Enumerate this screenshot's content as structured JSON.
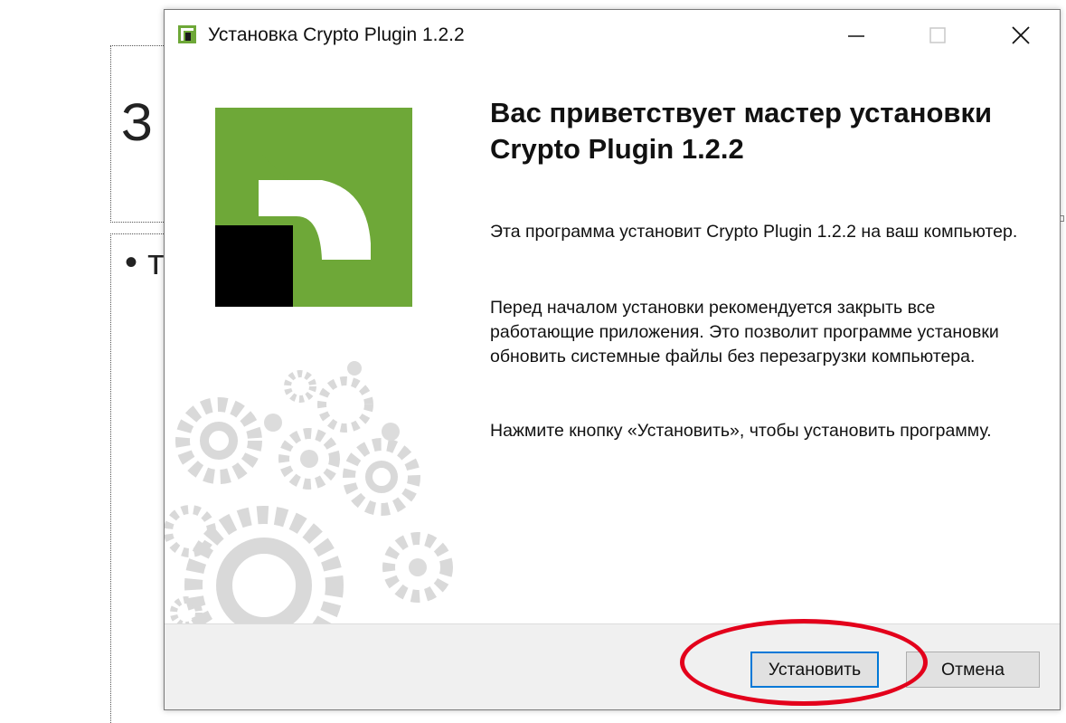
{
  "background": {
    "title_fragment": "З",
    "bullet_fragment": "• т"
  },
  "window": {
    "title": "Установка Crypto Plugin 1.2.2",
    "icons": {
      "app": "installer-logo-icon",
      "minimize": "minimize-icon",
      "maximize": "maximize-icon",
      "close": "close-icon"
    }
  },
  "content": {
    "heading": "Вас приветствует мастер установки Crypto Plugin 1.2.2",
    "paragraph_1": "Эта программа установит Crypto Plugin 1.2.2 на ваш компьютер.",
    "paragraph_2": "Перед началом установки рекомендуется закрыть все работающие приложения. Это позволит программе установки обновить системные файлы без перезагрузки компьютера.",
    "paragraph_3": "Нажмите кнопку «Установить», чтобы установить программу."
  },
  "footer": {
    "install_label": "Установить",
    "cancel_label": "Отмена"
  },
  "colors": {
    "brand_green": "#6ea838",
    "highlight_red": "#e3001b",
    "focus_blue": "#0078d7"
  }
}
